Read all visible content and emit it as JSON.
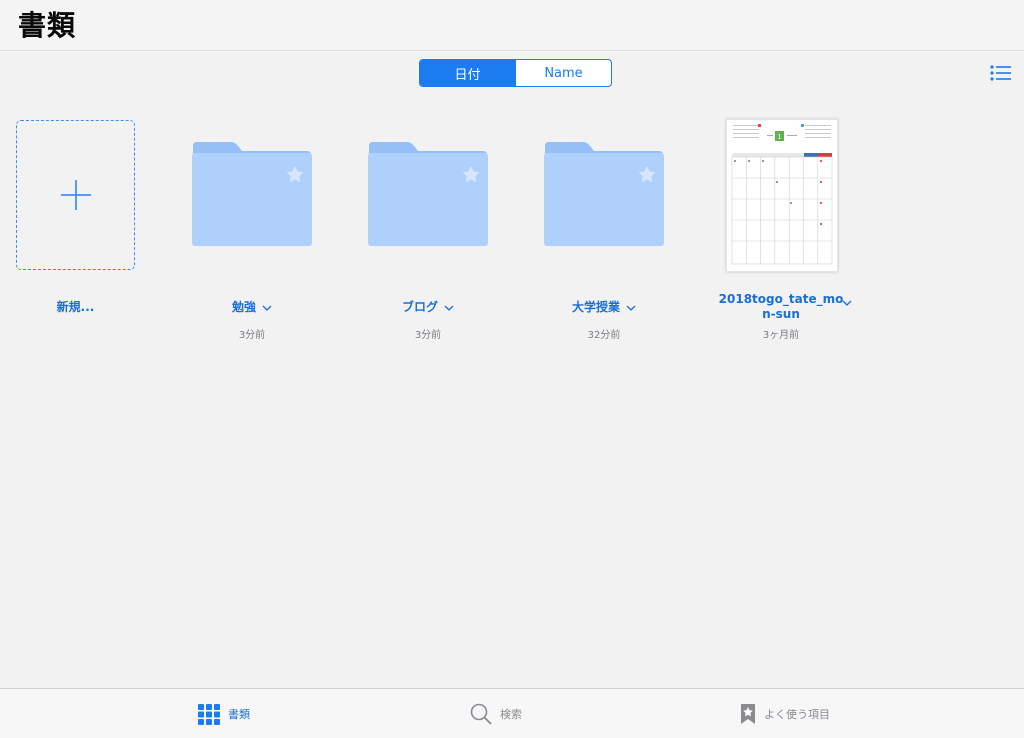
{
  "header": {
    "title": "書類"
  },
  "sort": {
    "options": [
      "日付",
      "Name"
    ],
    "selected": "日付"
  },
  "new_item": {
    "label": "新規..."
  },
  "folders": [
    {
      "name": "勉強",
      "date": "3分前"
    },
    {
      "name": "ブログ",
      "date": "3分前"
    },
    {
      "name": "大学授業",
      "date": "32分前"
    }
  ],
  "file": {
    "name_line1": "2018togo_tate_mo",
    "name_line2": "n-sun",
    "date": "3ヶ月前",
    "thumb_badge": "1"
  },
  "tabs": [
    {
      "label": "書類",
      "icon": "grid-icon",
      "active": true
    },
    {
      "label": "検索",
      "icon": "search-icon",
      "active": false
    },
    {
      "label": "よく使う項目",
      "icon": "bookmark-star-icon",
      "active": false
    }
  ],
  "colors": {
    "accent": "#1a7cf0",
    "folder": "#aed0fb",
    "folder_tab": "#95bff5"
  }
}
